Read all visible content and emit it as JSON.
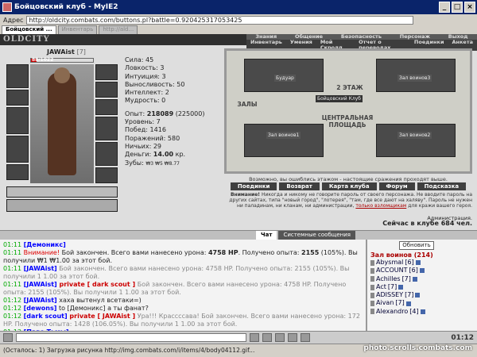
{
  "window": {
    "title": "Бойцовский клуб - MyIE2"
  },
  "address": {
    "label": "Адрес",
    "url": "http://oldcity.combats.com/buttons.pl?battle=0.920425317053425"
  },
  "tabs": [
    {
      "label": "Бойцовский ..."
    },
    {
      "label": "Инвентарь"
    },
    {
      "label": "http://ald..."
    }
  ],
  "game": {
    "logo": "OLDCITY",
    "menu_row1": [
      "Знания",
      "Общение",
      "Безопасность",
      "Персонаж",
      "Выход"
    ],
    "menu_row2": [
      "Инвентарь",
      "Умения",
      "Мой Скролл",
      "Отчет о переводах",
      "Поединки",
      "Анкета"
    ]
  },
  "character": {
    "name": "JAWAist",
    "level": "[7]",
    "hp": "88/1022",
    "hp_fraction": 0.086,
    "stats": [
      {
        "label": "Сила:",
        "value": "45"
      },
      {
        "label": "Ловкость:",
        "value": "3"
      },
      {
        "label": "Интуиция:",
        "value": "3"
      },
      {
        "label": "Выносливость:",
        "value": "50"
      },
      {
        "label": "Интеллект:",
        "value": "2"
      },
      {
        "label": "Мудрость:",
        "value": "0"
      }
    ],
    "exp_label": "Опыт:",
    "exp": "218089",
    "exp_next": "(225000)",
    "level_label": "Уровень:",
    "level_value": "7",
    "wins_label": "Побед:",
    "wins": "1416",
    "losses_label": "Поражений:",
    "losses": "580",
    "draws_label": "Ничьих:",
    "draws": "29",
    "money_label": "Деньги:",
    "money": "14.00",
    "money_unit": "кр.",
    "teeth_label": "Зубы:",
    "teeth": "₩3 ₩5 ₩8.77"
  },
  "map": {
    "floor": "2 ЭТАЖ",
    "club": "Бойцовский Клуб",
    "square": "ЦЕНТРАЛЬНАЯ ПЛОЩАДЬ",
    "halls": "ЗАЛЫ",
    "rooms": [
      "Будуар",
      "Зал воинов3",
      "Зал воинов1",
      "Зал воинов2"
    ],
    "hint": "Возможно, вы ошиблись этажом - настоящие сражения проходят выше.",
    "buttons": [
      "Поединки",
      "Возврат",
      "Карта клуба",
      "Форум",
      "Подсказка"
    ]
  },
  "warning": {
    "title": "Внимание!",
    "text": "Никогда и никому не говорите пароль от своего персонажа. Не вводите пароль на других сайтах, типа \"новый город\", \"лотерея\", \"там, где все дают на халяву\". Пароль не нужен ни паладинам, ни кланам, ни администрации,",
    "bold": "только взломщикам",
    "tail": "для кражи вашего героя.",
    "admin": "Администрация.",
    "online": "Сейчас в клубе 684 чел."
  },
  "chat_tabs": [
    "Чат",
    "Системные сообщения"
  ],
  "chat": [
    {
      "time": "01:11",
      "parts": [
        {
          "c": "n",
          "t": "[Демоникс]"
        }
      ]
    },
    {
      "time": "01:11",
      "parts": [
        {
          "c": "w",
          "t": "Внимание!"
        },
        {
          "c": "",
          "t": " Бой закончен. Всего вами нанесено урона: "
        },
        {
          "c": "b",
          "t": "4758 HP"
        },
        {
          "c": "",
          "t": ". Получено опыта: "
        },
        {
          "c": "b",
          "t": "2155"
        },
        {
          "c": "",
          "t": " (105%). Вы получили ₩1 ₩1.00 за этот бой."
        }
      ]
    },
    {
      "time": "01:11",
      "parts": [
        {
          "c": "n",
          "t": "[JAWAist]"
        },
        {
          "c": "g",
          "t": " Бой закончен. Всего вами нанесено урона: 4758 HP. Получено опыта: 2155 (105%). Вы получили 1 1.00 за этот бой."
        }
      ]
    },
    {
      "time": "01:11",
      "parts": [
        {
          "c": "n",
          "t": "[JAWAist]"
        },
        {
          "c": "p",
          "t": " private [ dark scout ]"
        },
        {
          "c": "g",
          "t": " Бой закончен. Всего вами нанесено урона: 4758 HP. Получено опыта: 2155 (105%). Вы получили 1 1.00 за этот бой."
        }
      ]
    },
    {
      "time": "01:12",
      "parts": [
        {
          "c": "n",
          "t": "[JAWAist]"
        },
        {
          "c": "",
          "t": " хаха вытенул всетаки=)"
        }
      ]
    },
    {
      "time": "01:12",
      "parts": [
        {
          "c": "n",
          "t": "[dewons]"
        },
        {
          "c": "",
          "t": " to [Демоникс] а ты фанат?"
        }
      ]
    },
    {
      "time": "01:12",
      "parts": [
        {
          "c": "n",
          "t": "[dark scout]"
        },
        {
          "c": "p",
          "t": " private [ JAWAist ]"
        },
        {
          "c": "g",
          "t": " Ура!!! Крассссава! Бой закончен. Всего вами нанесено урона: 172 HP. Получено опыта: 1428 (106.05%). Вы получили 1 1.00 за этот бой."
        }
      ]
    },
    {
      "time": "01:12",
      "parts": [
        {
          "c": "n",
          "t": "[Паве Тьмы]"
        }
      ]
    }
  ],
  "online": {
    "refresh": "Обновить",
    "title": "Зал воинов (214)",
    "users": [
      {
        "name": "Abysmal",
        "level": "[6]"
      },
      {
        "name": "ACCOUNT",
        "level": "[6]"
      },
      {
        "name": "Achilles",
        "level": "[7]"
      },
      {
        "name": "Act",
        "level": "[7]"
      },
      {
        "name": "ADISSEY",
        "level": "[7]"
      },
      {
        "name": "Aivan",
        "level": "[7]"
      },
      {
        "name": "Alexandro",
        "level": "[4]"
      }
    ]
  },
  "clock": "01:12",
  "status": "(Осталось: 1) Загрузка рисунка http://img.combats.com/i/items/4/body04112.gif...",
  "watermark": "photo.scrolls.combats.com"
}
